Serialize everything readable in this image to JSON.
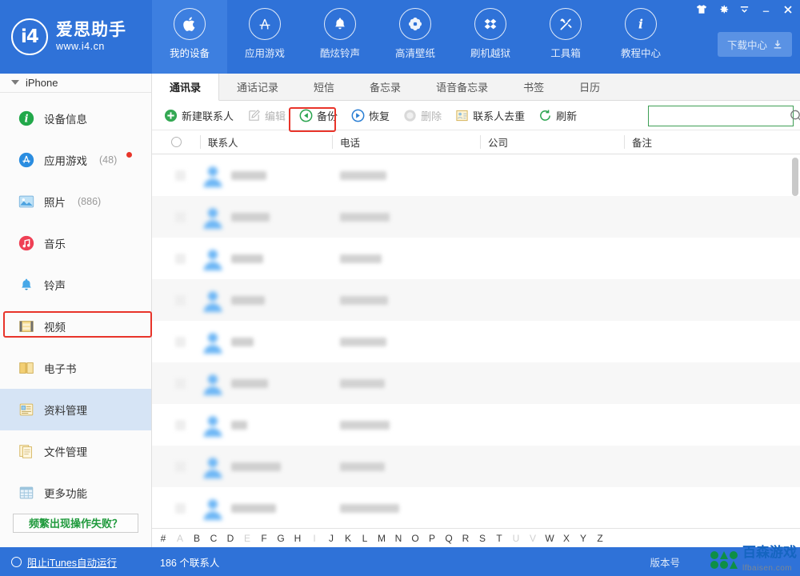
{
  "brand": {
    "name": "爱思助手",
    "url": "www.i4.cn",
    "logo_text": "i4"
  },
  "topnav": {
    "items": [
      {
        "label": "我的设备",
        "icon": "apple-icon",
        "active": true
      },
      {
        "label": "应用游戏",
        "icon": "appstore-icon",
        "active": false
      },
      {
        "label": "酷炫铃声",
        "icon": "bell-icon",
        "active": false
      },
      {
        "label": "高清壁纸",
        "icon": "flower-icon",
        "active": false
      },
      {
        "label": "刷机越狱",
        "icon": "box-icon",
        "active": false
      },
      {
        "label": "工具箱",
        "icon": "tools-icon",
        "active": false
      },
      {
        "label": "教程中心",
        "icon": "info-icon",
        "active": false
      }
    ],
    "download_center": "下载中心",
    "window_controls": [
      "skin-icon",
      "gear-icon",
      "minimize-tray-icon",
      "minimize-icon",
      "close-icon"
    ]
  },
  "sidebar": {
    "device": "iPhone",
    "items": [
      {
        "label": "设备信息",
        "count": "",
        "icon": "info-circle-icon",
        "badge": false,
        "active": false
      },
      {
        "label": "应用游戏",
        "count": "(48)",
        "icon": "appstore-icon",
        "badge": true,
        "active": false
      },
      {
        "label": "照片",
        "count": "(886)",
        "icon": "photo-icon",
        "badge": false,
        "active": false
      },
      {
        "label": "音乐",
        "count": "",
        "icon": "music-icon",
        "badge": false,
        "active": false
      },
      {
        "label": "铃声",
        "count": "",
        "icon": "ringtone-icon",
        "badge": false,
        "active": false
      },
      {
        "label": "视频",
        "count": "",
        "icon": "video-icon",
        "badge": false,
        "active": false
      },
      {
        "label": "电子书",
        "count": "",
        "icon": "book-icon",
        "badge": false,
        "active": false
      },
      {
        "label": "资料管理",
        "count": "",
        "icon": "data-manage-icon",
        "badge": false,
        "active": true
      },
      {
        "label": "文件管理",
        "count": "",
        "icon": "file-manage-icon",
        "badge": false,
        "active": false
      },
      {
        "label": "更多功能",
        "count": "",
        "icon": "more-grid-icon",
        "badge": false,
        "active": false
      }
    ],
    "fail_button": "频繁出现操作失败？"
  },
  "tabs": [
    {
      "label": "通讯录",
      "active": true
    },
    {
      "label": "通话记录",
      "active": false
    },
    {
      "label": "短信",
      "active": false
    },
    {
      "label": "备忘录",
      "active": false
    },
    {
      "label": "语音备忘录",
      "active": false
    },
    {
      "label": "书签",
      "active": false
    },
    {
      "label": "日历",
      "active": false
    }
  ],
  "toolbar": {
    "buttons": [
      {
        "label": "新建联系人",
        "icon": "plus-circle-icon",
        "disabled": false,
        "highlighted": false
      },
      {
        "label": "编辑",
        "icon": "pencil-icon",
        "disabled": true,
        "highlighted": false
      },
      {
        "label": "备份",
        "icon": "backup-arrow-icon",
        "disabled": false,
        "highlighted": true
      },
      {
        "label": "恢复",
        "icon": "restore-arrow-icon",
        "disabled": false,
        "highlighted": false
      },
      {
        "label": "删除",
        "icon": "delete-circle-icon",
        "disabled": true,
        "highlighted": false
      },
      {
        "label": "联系人去重",
        "icon": "dedupe-card-icon",
        "disabled": false,
        "highlighted": false
      },
      {
        "label": "刷新",
        "icon": "refresh-icon",
        "disabled": false,
        "highlighted": false
      }
    ]
  },
  "search": {
    "value": "",
    "placeholder": "",
    "icon": "search-icon",
    "border_color": "#3e9e55"
  },
  "table": {
    "columns": [
      "联系人",
      "电话",
      "公司",
      "备注"
    ],
    "rows": [
      {
        "name_w": 56,
        "phone_w": 74
      },
      {
        "name_w": 62,
        "phone_w": 56
      },
      {
        "name_w": 20,
        "phone_w": 62
      },
      {
        "name_w": 46,
        "phone_w": 56
      },
      {
        "name_w": 28,
        "phone_w": 58
      },
      {
        "name_w": 42,
        "phone_w": 60
      },
      {
        "name_w": 40,
        "phone_w": 52
      },
      {
        "name_w": 48,
        "phone_w": 62
      },
      {
        "name_w": 44,
        "phone_w": 58
      }
    ]
  },
  "alphabet": {
    "letters": [
      "#",
      "A",
      "B",
      "C",
      "D",
      "E",
      "F",
      "G",
      "H",
      "I",
      "J",
      "K",
      "L",
      "M",
      "N",
      "O",
      "P",
      "Q",
      "R",
      "S",
      "T",
      "U",
      "V",
      "W",
      "X",
      "Y",
      "Z"
    ],
    "disabled": [
      "A",
      "E",
      "I",
      "U",
      "V"
    ]
  },
  "statusbar": {
    "itunes_label": "阻止iTunes自动运行",
    "contact_count": "186 个联系人",
    "version_label": "版本号"
  },
  "watermark": {
    "main": "百森游戏",
    "sub": "lfbaisen.com"
  },
  "annotations": {
    "highlight_color": "#e8342a",
    "boxes": [
      "backup-button",
      "sidebar-item-data-manage"
    ]
  },
  "colors": {
    "header_blue": "#2f72d8",
    "accent_green": "#1f9a3c",
    "active_sidebar": "#d6e4f5"
  }
}
